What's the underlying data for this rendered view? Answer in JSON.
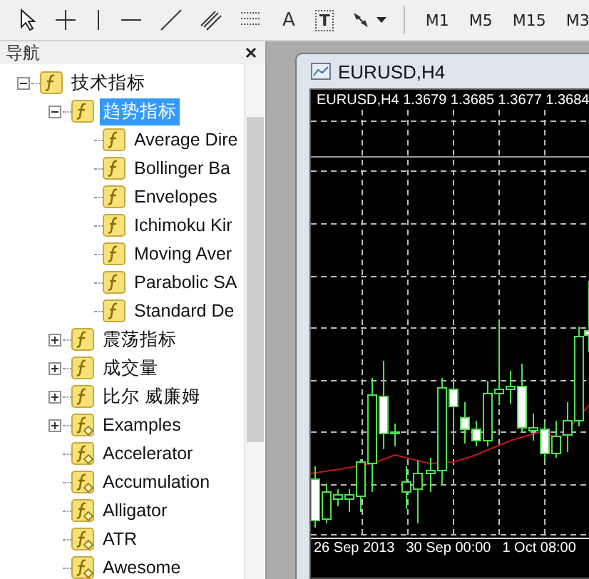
{
  "toolbar": {
    "text_tools": [
      "A",
      "T"
    ],
    "timeframes": [
      {
        "label": "M1",
        "selected": false
      },
      {
        "label": "M5",
        "selected": false
      },
      {
        "label": "M15",
        "selected": false
      },
      {
        "label": "M3",
        "selected": false
      }
    ]
  },
  "navigator": {
    "title": "导航",
    "tree": [
      {
        "label": "技术指标",
        "kind": "builtin",
        "expanded": true,
        "selected": false,
        "children": [
          {
            "label": "趋势指标",
            "kind": "builtin",
            "expanded": true,
            "selected": true,
            "children": [
              {
                "label": "Average Dire",
                "kind": "builtin",
                "selected": false
              },
              {
                "label": "Bollinger Ba",
                "kind": "builtin",
                "selected": false
              },
              {
                "label": "Envelopes",
                "kind": "builtin",
                "selected": false
              },
              {
                "label": "Ichimoku Kir",
                "kind": "builtin",
                "selected": false
              },
              {
                "label": "Moving Aver",
                "kind": "builtin",
                "selected": false
              },
              {
                "label": "Parabolic SA",
                "kind": "builtin",
                "selected": false
              },
              {
                "label": "Standard De",
                "kind": "builtin",
                "selected": false
              }
            ]
          },
          {
            "label": "震荡指标",
            "kind": "builtin",
            "expanded": false,
            "selected": false
          },
          {
            "label": "成交量",
            "kind": "builtin",
            "expanded": false,
            "selected": false
          },
          {
            "label": "比尔 威廉姆",
            "kind": "builtin",
            "expanded": false,
            "selected": false
          },
          {
            "label": "Examples",
            "kind": "custom",
            "expanded": false,
            "selected": false
          },
          {
            "label": "Accelerator",
            "kind": "custom",
            "selected": false
          },
          {
            "label": "Accumulation",
            "kind": "custom",
            "selected": false
          },
          {
            "label": "Alligator",
            "kind": "custom",
            "selected": false
          },
          {
            "label": "ATR",
            "kind": "custom",
            "selected": false
          },
          {
            "label": "Awesome",
            "kind": "custom",
            "selected": false
          }
        ]
      }
    ]
  },
  "chart_window": {
    "title": "EURUSD,H4",
    "header": "EURUSD,H4  1.3679 1.3685 1.3677 1.3684",
    "time_labels": [
      "26 Sep 2013",
      "30 Sep 00:00",
      "1 Oct 08:00"
    ]
  }
}
